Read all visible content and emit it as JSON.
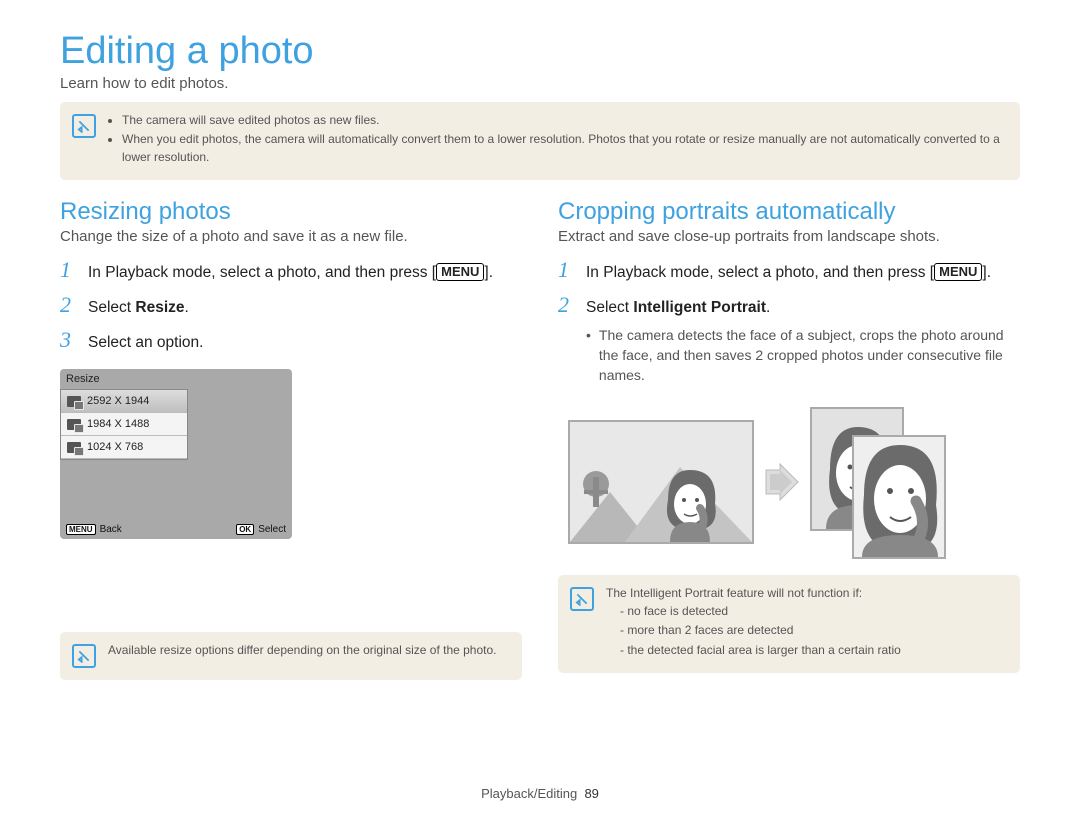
{
  "page_title": "Editing a photo",
  "page_subtitle": "Learn how to edit photos.",
  "top_note_bullets": [
    "The camera will save edited photos as new files.",
    "When you edit photos, the camera will automatically convert them to a lower resolution. Photos that you rotate or resize manually are not automatically converted to a lower resolution."
  ],
  "left": {
    "heading": "Resizing photos",
    "sub": "Change the size of a photo and save it as a new file.",
    "steps": [
      {
        "pre": "In Playback mode, select a photo, and then press [",
        "menu": "MENU",
        "post": "]."
      },
      {
        "plain_pre": "Select ",
        "bold": "Resize",
        "plain_post": "."
      },
      {
        "plain": "Select an option."
      }
    ],
    "menu": {
      "title": "Resize",
      "items": [
        "2592 X 1944",
        "1984 X 1488",
        "1024 X 768"
      ],
      "back": "Back",
      "select": "Select",
      "back_btn": "MENU",
      "ok_btn": "OK"
    },
    "note": "Available resize options differ depending on the original size of the photo."
  },
  "right": {
    "heading": "Cropping portraits automatically",
    "sub": "Extract and save close-up portraits from landscape shots.",
    "steps": [
      {
        "pre": "In Playback mode, select a photo, and then press [",
        "menu": "MENU",
        "post": "]."
      },
      {
        "plain_pre": "Select ",
        "bold": "Intelligent Portrait",
        "plain_post": ".",
        "bullets": [
          "The camera detects the face of a subject, crops the photo around the face, and then saves 2 cropped photos under consecutive file names."
        ]
      }
    ],
    "note_intro": "The Intelligent Portrait feature will not function if:",
    "note_items": [
      "no face is detected",
      "more than 2 faces are detected",
      "the detected facial area is larger than a certain ratio"
    ]
  },
  "footer_section": "Playback/Editing",
  "footer_page": "89"
}
